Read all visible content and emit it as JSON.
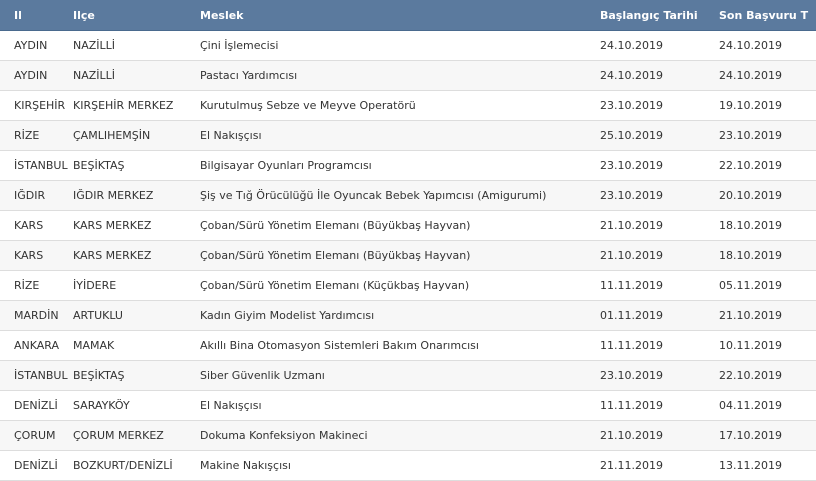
{
  "header": {
    "il": "Il",
    "ilce": "Ilçe",
    "meslek": "Meslek",
    "baslangic": "Başlangıç Tarihi",
    "son": "Son Başvuru T"
  },
  "rows": [
    {
      "il": "AYDIN",
      "ilce": "NAZİLLİ",
      "meslek": "Çini İşlemecisi",
      "baslangic": "24.10.2019",
      "son": "24.10.2019"
    },
    {
      "il": "AYDIN",
      "ilce": "NAZİLLİ",
      "meslek": "Pastacı Yardımcısı",
      "baslangic": "24.10.2019",
      "son": "24.10.2019"
    },
    {
      "il": "KIRŞEHİR",
      "ilce": "KIRŞEHİR MERKEZ",
      "meslek": "Kurutulmuş Sebze ve Meyve Operatörü",
      "baslangic": "23.10.2019",
      "son": "19.10.2019"
    },
    {
      "il": "RİZE",
      "ilce": "ÇAMLIHEMŞİN",
      "meslek": "El Nakışçısı",
      "baslangic": "25.10.2019",
      "son": "23.10.2019"
    },
    {
      "il": "İSTANBUL",
      "ilce": "BEŞİKTAŞ",
      "meslek": "Bilgisayar Oyunları Programcısı",
      "baslangic": "23.10.2019",
      "son": "22.10.2019"
    },
    {
      "il": "IĞDIR",
      "ilce": "IĞDIR MERKEZ",
      "meslek": "Şiş ve Tığ Örücülüğü İle Oyuncak Bebek Yapımcısı (Amigurumi)",
      "baslangic": "23.10.2019",
      "son": "20.10.2019"
    },
    {
      "il": "KARS",
      "ilce": "KARS MERKEZ",
      "meslek": "Çoban/Sürü Yönetim Elemanı (Büyükbaş Hayvan)",
      "baslangic": "21.10.2019",
      "son": "18.10.2019"
    },
    {
      "il": "KARS",
      "ilce": "KARS MERKEZ",
      "meslek": "Çoban/Sürü Yönetim Elemanı (Büyükbaş Hayvan)",
      "baslangic": "21.10.2019",
      "son": "18.10.2019"
    },
    {
      "il": "RİZE",
      "ilce": "İYİDERE",
      "meslek": "Çoban/Sürü Yönetim Elemanı (Küçükbaş Hayvan)",
      "baslangic": "11.11.2019",
      "son": "05.11.2019"
    },
    {
      "il": "MARDİN",
      "ilce": "ARTUKLU",
      "meslek": "Kadın Giyim Modelist Yardımcısı",
      "baslangic": "01.11.2019",
      "son": "21.10.2019"
    },
    {
      "il": "ANKARA",
      "ilce": "MAMAK",
      "meslek": "Akıllı Bina Otomasyon Sistemleri Bakım Onarımcısı",
      "baslangic": "11.11.2019",
      "son": "10.11.2019"
    },
    {
      "il": "İSTANBUL",
      "ilce": "BEŞİKTAŞ",
      "meslek": "Siber Güvenlik Uzmanı",
      "baslangic": "23.10.2019",
      "son": "22.10.2019"
    },
    {
      "il": "DENİZLİ",
      "ilce": "SARAYKÖY",
      "meslek": "El Nakışçısı",
      "baslangic": "11.11.2019",
      "son": "04.11.2019"
    },
    {
      "il": "ÇORUM",
      "ilce": "ÇORUM MERKEZ",
      "meslek": "Dokuma Konfeksiyon Makineci",
      "baslangic": "21.10.2019",
      "son": "17.10.2019"
    },
    {
      "il": "DENİZLİ",
      "ilce": "BOZKURT/DENİZLİ",
      "meslek": "Makine Nakışçısı",
      "baslangic": "21.11.2019",
      "son": "13.11.2019"
    }
  ],
  "colors": {
    "header_bg": "#5b7a9e",
    "row_alt_bg": "#f7f7f7",
    "text": "#333333",
    "link": "#2a5d9f"
  }
}
